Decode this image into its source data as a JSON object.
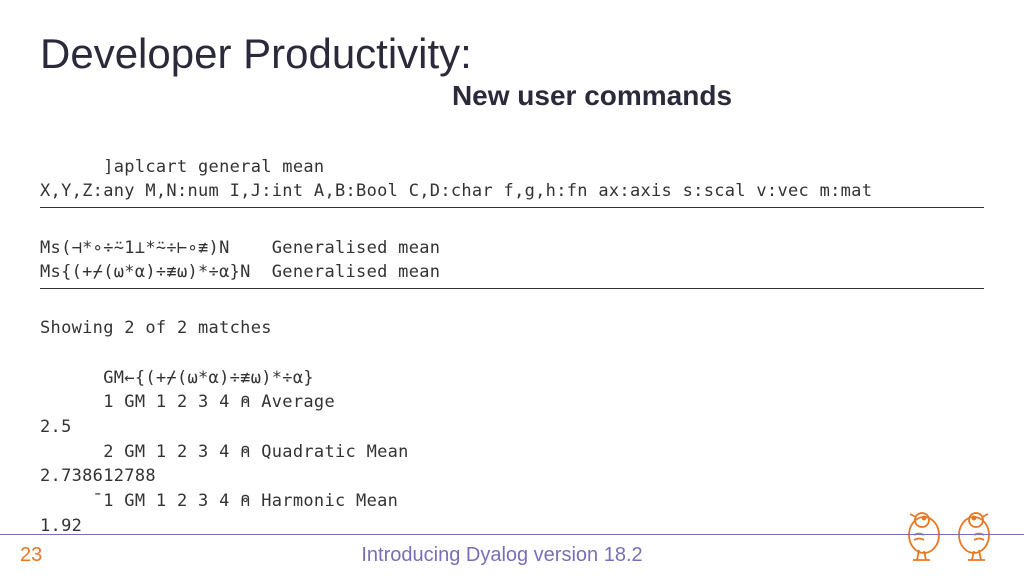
{
  "title": "Developer Productivity:",
  "subtitle": "New user commands",
  "code": {
    "line1": "      ]aplcart general mean",
    "line2": "X,Y,Z:any M,N:num I,J:int A,B:Bool C,D:char f,g,h:fn ax:axis s:scal v:vec m:mat",
    "line3": "Ms(⊣*∘÷⍨1⊥*⍨÷⊢∘≢)N    Generalised mean",
    "line4": "Ms{(+⌿(⍵*⍺)÷≢⍵)*÷⍺}N  Generalised mean",
    "line5": "Showing 2 of 2 matches",
    "line6": "",
    "line7": "      GM←{(+⌿(⍵*⍺)÷≢⍵)*÷⍺}",
    "line8": "      1 GM 1 2 3 4 ⍝ Average",
    "line9": "2.5",
    "line10": "      2 GM 1 2 3 4 ⍝ Quadratic Mean",
    "line11": "2.738612788",
    "line12": "     ¯1 GM 1 2 3 4 ⍝ Harmonic Mean",
    "line13": "1.92"
  },
  "footer": {
    "page": "23",
    "title": "Introducing Dyalog version 18.2"
  }
}
